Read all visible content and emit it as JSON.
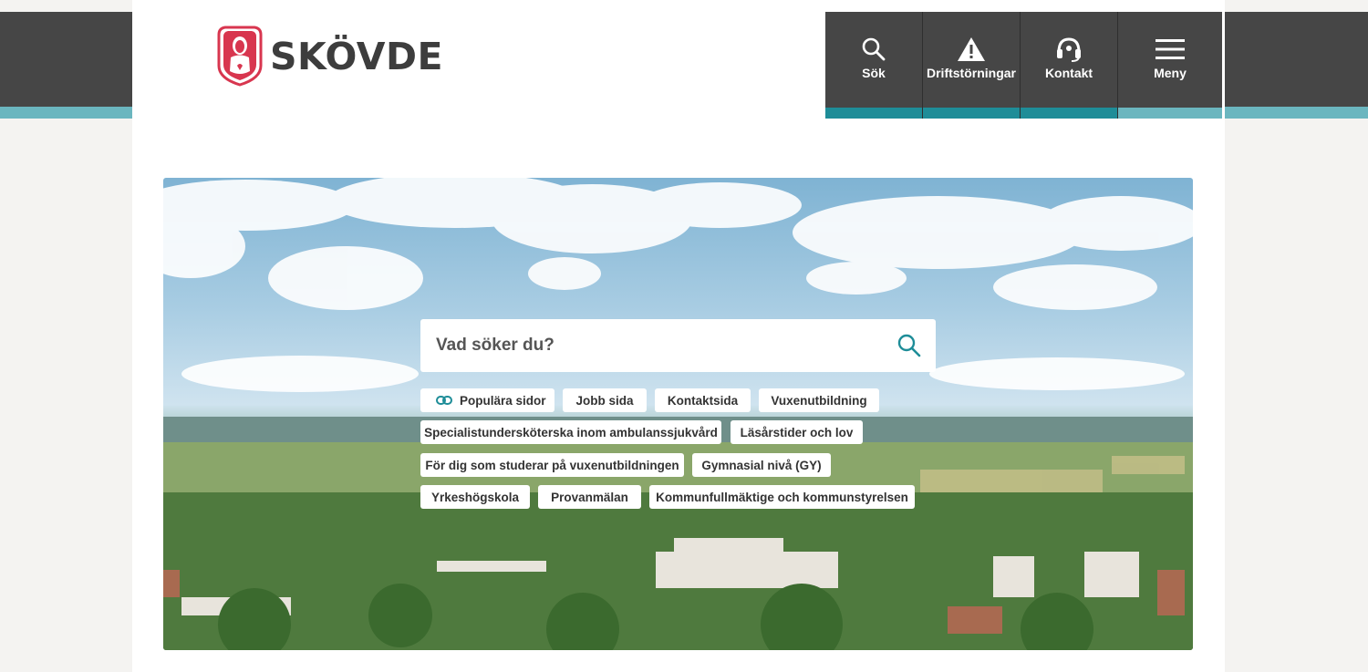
{
  "brand": {
    "name": "SKÖVDE"
  },
  "colors": {
    "header_bg": "#464646",
    "accent_teal": "#6bb6bf",
    "active_teal": "#1e8d98",
    "logo_red": "#d8364f"
  },
  "nav": [
    {
      "label": "Sök",
      "icon": "search-icon"
    },
    {
      "label": "Driftstörningar",
      "icon": "warning-icon"
    },
    {
      "label": "Kontakt",
      "icon": "headset-icon"
    },
    {
      "label": "Meny",
      "icon": "menu-icon"
    }
  ],
  "search": {
    "placeholder": "Vad söker du?",
    "icon": "search-icon"
  },
  "popular": {
    "label": "Populära sidor",
    "icon": "link-icon",
    "items": [
      "Jobb sida",
      "Kontaktsida",
      "Vuxenutbildning",
      "Specialistundersköterska inom ambulanssjukvård",
      "Läsårstider och lov",
      "För dig som studerar på vuxenutbildningen",
      "Gymnasial nivå (GY)",
      "Yrkeshögskola",
      "Provanmälan",
      "Kommunfullmäktige och kommunstyrelsen"
    ]
  }
}
